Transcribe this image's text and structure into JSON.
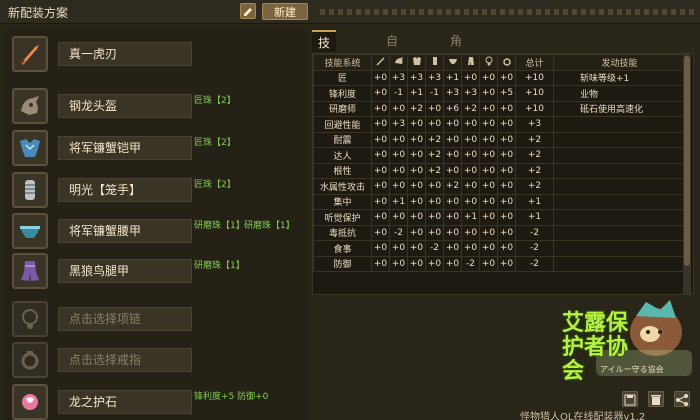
{
  "header": {
    "title": "新配装方案",
    "new_label": "新建"
  },
  "equipment": [
    {
      "name": "真一虎刃",
      "slots": [],
      "icon": "weapon-icon",
      "empty": false
    },
    {
      "name": "钢龙头盔",
      "slots": [
        "匠珠【2】"
      ],
      "icon": "helmet-icon",
      "empty": false
    },
    {
      "name": "将军镰蟹铠甲",
      "slots": [
        "匠珠【2】"
      ],
      "icon": "chest-armor-icon",
      "empty": false
    },
    {
      "name": "明光【笼手】",
      "slots": [
        "匠珠【2】"
      ],
      "icon": "gauntlet-icon",
      "empty": false
    },
    {
      "name": "将军镰蟹腰甲",
      "slots": [
        "研磨珠【1】",
        "研磨珠【1】"
      ],
      "icon": "waist-armor-icon",
      "empty": false
    },
    {
      "name": "黑狼鸟腿甲",
      "slots": [
        "研磨珠【1】"
      ],
      "icon": "leg-armor-icon",
      "empty": false
    },
    {
      "name": "点击选择项链",
      "slots": [],
      "icon": "necklace-icon",
      "empty": true
    },
    {
      "name": "点击选择戒指",
      "slots": [],
      "icon": "ring-icon",
      "empty": true
    },
    {
      "name": "龙之护石",
      "slots": [
        "锋利度+5 防御+0"
      ],
      "icon": "talisman-icon",
      "empty": false
    }
  ],
  "tabs": [
    "技能详情",
    "自动配装",
    "角色信息"
  ],
  "table": {
    "header_system": "技能系统",
    "header_total": "总计",
    "header_activated": "发动技能",
    "rows": [
      {
        "skill": "匠",
        "vals": [
          "+0",
          "+3",
          "+3",
          "+3",
          "+1",
          "+0",
          "+0",
          "+0"
        ],
        "total": "+10",
        "activated": "斩味等级+1"
      },
      {
        "skill": "锋利度",
        "vals": [
          "+0",
          "-1",
          "+1",
          "-1",
          "+3",
          "+3",
          "+0",
          "+5"
        ],
        "total": "+10",
        "activated": "业物"
      },
      {
        "skill": "研磨师",
        "vals": [
          "+0",
          "+0",
          "+2",
          "+0",
          "+6",
          "+2",
          "+0",
          "+0"
        ],
        "total": "+10",
        "activated": "砥石使用高速化"
      },
      {
        "skill": "回避性能",
        "vals": [
          "+0",
          "+3",
          "+0",
          "+0",
          "+0",
          "+0",
          "+0",
          "+0"
        ],
        "total": "+3",
        "activated": ""
      },
      {
        "skill": "耐震",
        "vals": [
          "+0",
          "+0",
          "+0",
          "+2",
          "+0",
          "+0",
          "+0",
          "+0"
        ],
        "total": "+2",
        "activated": ""
      },
      {
        "skill": "达人",
        "vals": [
          "+0",
          "+0",
          "+0",
          "+2",
          "+0",
          "+0",
          "+0",
          "+0"
        ],
        "total": "+2",
        "activated": ""
      },
      {
        "skill": "根性",
        "vals": [
          "+0",
          "+0",
          "+0",
          "+2",
          "+0",
          "+0",
          "+0",
          "+0"
        ],
        "total": "+2",
        "activated": ""
      },
      {
        "skill": "水属性攻击",
        "vals": [
          "+0",
          "+0",
          "+0",
          "+0",
          "+2",
          "+0",
          "+0",
          "+0"
        ],
        "total": "+2",
        "activated": ""
      },
      {
        "skill": "集中",
        "vals": [
          "+0",
          "+1",
          "+0",
          "+0",
          "+0",
          "+0",
          "+0",
          "+0"
        ],
        "total": "+1",
        "activated": ""
      },
      {
        "skill": "听觉保护",
        "vals": [
          "+0",
          "+0",
          "+0",
          "+0",
          "+0",
          "+1",
          "+0",
          "+0"
        ],
        "total": "+1",
        "activated": ""
      },
      {
        "skill": "毒抵抗",
        "vals": [
          "+0",
          "-2",
          "+0",
          "+0",
          "+0",
          "+0",
          "+0",
          "+0"
        ],
        "total": "-2",
        "activated": ""
      },
      {
        "skill": "食事",
        "vals": [
          "+0",
          "+0",
          "+0",
          "-2",
          "+0",
          "+0",
          "+0",
          "+0"
        ],
        "total": "-2",
        "activated": ""
      },
      {
        "skill": "防御",
        "vals": [
          "+0",
          "+0",
          "+0",
          "+0",
          "+0",
          "-2",
          "+0",
          "+0"
        ],
        "total": "-2",
        "activated": ""
      }
    ]
  },
  "logo": {
    "text": "艾露保护者协会",
    "subtitle": "アイルー守る協会"
  },
  "footer": {
    "text": "怪物猎人OL在线配装器v1.2"
  },
  "colors": {
    "accent": "#c8a058",
    "slot_text": "#7bd04a",
    "background": "#2a2519"
  }
}
